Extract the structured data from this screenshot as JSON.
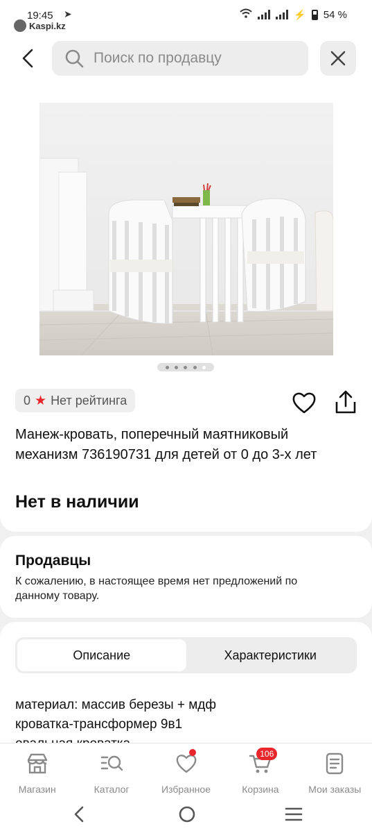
{
  "status_bar": {
    "time": "19:45",
    "app_name": "Kaspi.kz",
    "battery": "54 %"
  },
  "search": {
    "placeholder": "Поиск по продавцу"
  },
  "product": {
    "rating_value": "0",
    "rating_text": "Нет рейтинга",
    "title": "Манеж-кровать, поперечный маятниковый механизм 736190731 для детей от 0 до 3-х лет",
    "stock_status": "Нет в наличии",
    "image_count": 5,
    "active_image": 4
  },
  "sellers": {
    "title": "Продавцы",
    "message": "К сожалению, в настоящее время нет предложений по данному товару."
  },
  "tabs": [
    {
      "label": "Описание",
      "active": true
    },
    {
      "label": "Характеристики",
      "active": false
    }
  ],
  "description": {
    "lines": [
      "материал: массив березы + мдф",
      "кроватка-трансформер 9в1",
      "овальная кроватка"
    ]
  },
  "bottom_nav": [
    {
      "label": "Магазин",
      "icon": "store-icon"
    },
    {
      "label": "Каталог",
      "icon": "catalog-search-icon"
    },
    {
      "label": "Избранное",
      "icon": "heart-icon",
      "dot": true
    },
    {
      "label": "Корзина",
      "icon": "cart-icon",
      "badge": "106"
    },
    {
      "label": "Мои заказы",
      "icon": "orders-icon"
    }
  ],
  "colors": {
    "accent_red": "#e8262b",
    "background": "#f0f0f0",
    "card": "#ffffff"
  }
}
